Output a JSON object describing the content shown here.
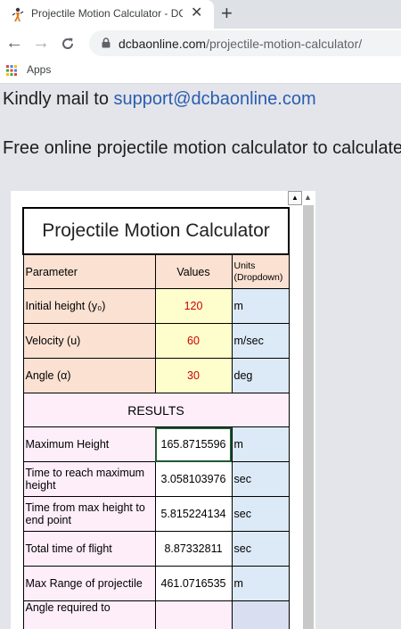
{
  "browser": {
    "tab_title": "Projectile Motion Calculator - DC",
    "close_glyph": "✕",
    "new_tab_glyph": "+",
    "back_glyph": "←",
    "forward_glyph": "→",
    "reload_glyph": "C",
    "url_host": "dcbaonline.com",
    "url_path": "/projectile-motion-calculator/",
    "bookmarks_apps": "Apps"
  },
  "page": {
    "mail_prefix": "Kindly mail to ",
    "mail_link": "support@dcbaonline.com",
    "free_text": "Free online projectile motion calculator to calculate"
  },
  "calculator": {
    "title": "Projectile Motion Calculator",
    "headers": {
      "parameter": "Parameter",
      "values": "Values",
      "units_line1": "Units",
      "units_line2": "(Dropdown)"
    },
    "inputs": [
      {
        "label": "Initial height (y₀)",
        "value": "120",
        "unit": "m"
      },
      {
        "label": "Velocity (u)",
        "value": "60",
        "unit": "m/sec"
      },
      {
        "label": "Angle (α)",
        "value": "30",
        "unit": "deg"
      }
    ],
    "results_label": "RESULTS",
    "results": [
      {
        "label": "Maximum Height",
        "value": "165.8715596",
        "unit": "m"
      },
      {
        "label": "Time to reach maximum height",
        "value": "3.058103976",
        "unit": "sec"
      },
      {
        "label": "Time from max height to end point",
        "value": "5.815224134",
        "unit": "sec"
      },
      {
        "label": "Total time of flight",
        "value": "8.87332811",
        "unit": "sec"
      },
      {
        "label": "Max Range of projectile",
        "value": "461.0716535",
        "unit": "m"
      },
      {
        "label": "Angle required to",
        "value": "",
        "unit": ""
      }
    ]
  },
  "colors": {
    "param_bg": "#fbe1d2",
    "value_bg": "#fefecd",
    "value_text": "#cc0000",
    "unit_bg": "#dce9f6",
    "results_bg": "#fdeefa",
    "link": "#2a5db0"
  }
}
